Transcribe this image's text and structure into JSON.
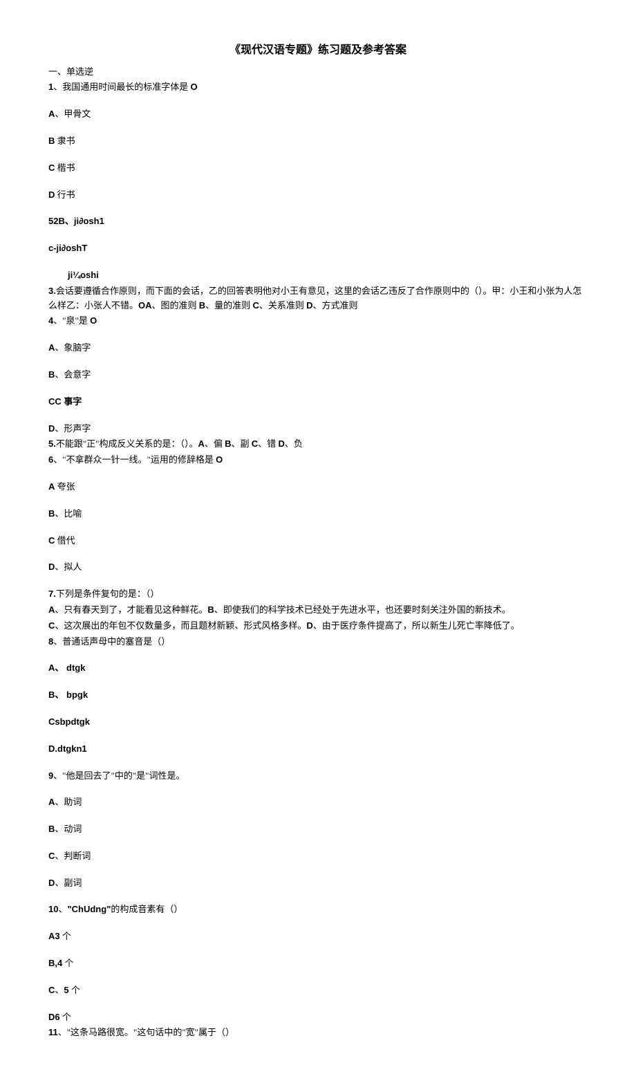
{
  "title": "《现代汉语专题》练习题及参考答案",
  "section1": "一、单选逆",
  "q1": {
    "stem": "、我国通用时间最长的标准字体是 ",
    "num": "1",
    "end": "O",
    "a": "、甲骨文",
    "a_label": "A",
    "b": " 隶书",
    "b_label": "B",
    "c": " 楷书",
    "c_label": "C",
    "d": " 行书",
    "d_label": "D"
  },
  "q2": {
    "line1": "52B、ji∂osh1",
    "line2": "c-ji∂oshT",
    "line3": "ji¼oshi"
  },
  "q3": {
    "num": "3.",
    "text": "会话要遵循合作原则，而下面的会话，乙的回答表明他对小王有意见，这里的会话乙违反了合作原则中的（）。甲：小王和小张为人怎么样乙：小张人不错。",
    "opts": "、图的准则 ",
    "oa": "OA",
    "b": "B",
    "btext": "、量的准则 ",
    "c": "C",
    "ctext": "、关系准则 ",
    "d": "D",
    "dtext": "、方式准则"
  },
  "q4": {
    "num": "4",
    "stem": "、\"泉\"是 ",
    "end": "O",
    "a": "、象脑字",
    "a_label": "A",
    "b": "、会意字",
    "b_label": "B",
    "c": " 事字",
    "c_label": "CC",
    "d": "、形声字",
    "d_label": "D"
  },
  "q5": {
    "num": "5.",
    "text": "不能跟\"正\"构成反义关系的是：（）。",
    "a": "A",
    "atext": "、偏 ",
    "b": "B",
    "btext": "、副 ",
    "c": "C",
    "ctext": "、错 ",
    "d": "D",
    "dtext": "、负"
  },
  "q6": {
    "num": "6",
    "stem": "、\"不拿群众一针一线。\"运用的修辞格是 ",
    "end": "O",
    "a": " 夸张",
    "a_label": "A",
    "b": "、比喻",
    "b_label": "B",
    "c": " 借代",
    "c_label": "C",
    "d": "、拟人",
    "d_label": "D"
  },
  "q7": {
    "num": "7.",
    "stem": "下列是条件复句的是：（）",
    "a": "A",
    "atext": "、只有春天到了，才能看见这种鲜花。",
    "b": "B",
    "btext": "、即使我们的科学技术已经处于先进水平，也还要时刻关注外国的新技术。",
    "c": "C",
    "ctext": "、这次展出的年包不仅数量多，而且题材新颖、形式风格多样。",
    "d": "D",
    "dtext": "、由于医疗条件提高了，所以新生儿死亡率降低了。"
  },
  "q8": {
    "num": "8",
    "stem": "、普通话声母中的塞音是（）",
    "a": "、 dtgk",
    "a_label": "A",
    "b": "、 bpgk",
    "b_label": "B",
    "c": "Csbpdtgk",
    "d": "D.dtgkn1"
  },
  "q9": {
    "num": "9",
    "stem": "、\"他是回去了\"中的\"是\"词性是。",
    "a": "、助词",
    "a_label": "A",
    "b": "、动词",
    "b_label": "B",
    "c": "、判断词",
    "c_label": "C",
    "d": "、副词",
    "d_label": "D"
  },
  "q10": {
    "num": "10",
    "stem1": "、",
    "stem2": "\"ChUdng\"",
    "stem3": "的构成音素有（）",
    "a": " 个",
    "a_label": "A3",
    "b": " 个",
    "b_label": "B,4",
    "c": " 个",
    "c_pre": "C",
    "c_num": "5",
    "c_sep": "、",
    "d": " 个",
    "d_label": "D6"
  },
  "q11": {
    "num": "11",
    "stem": "、\"这条马路很宽。\"这句话中的\"宽\"属于（）"
  }
}
